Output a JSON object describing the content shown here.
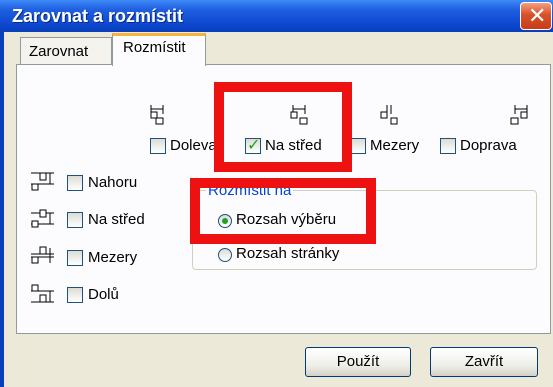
{
  "window": {
    "title": "Zarovnat a rozmístit"
  },
  "tabs": [
    "Zarovnat",
    "Rozmístit"
  ],
  "horizontal": {
    "options": [
      {
        "label": "Doleva",
        "checked": false,
        "icon": "distribute-left-icon"
      },
      {
        "label": "Na střed",
        "checked": true,
        "icon": "distribute-center-h-icon"
      },
      {
        "label": "Mezery",
        "checked": false,
        "icon": "distribute-spacing-h-icon"
      },
      {
        "label": "Doprava",
        "checked": false,
        "icon": "distribute-right-icon"
      }
    ]
  },
  "vertical": {
    "options": [
      {
        "label": "Nahoru",
        "checked": false,
        "icon": "distribute-top-icon"
      },
      {
        "label": "Na střed",
        "checked": false,
        "icon": "distribute-middle-v-icon"
      },
      {
        "label": "Mezery",
        "checked": false,
        "icon": "distribute-spacing-v-icon"
      },
      {
        "label": "Dolů",
        "checked": false,
        "icon": "distribute-bottom-icon"
      }
    ]
  },
  "distribute_to": {
    "legend": "Rozmístit na",
    "options": [
      {
        "label": "Rozsah výběru",
        "selected": true
      },
      {
        "label": "Rozsah stránky",
        "selected": false
      }
    ]
  },
  "buttons": {
    "apply": "Použít",
    "close": "Zavřít"
  },
  "highlight_color": "#ee1111"
}
